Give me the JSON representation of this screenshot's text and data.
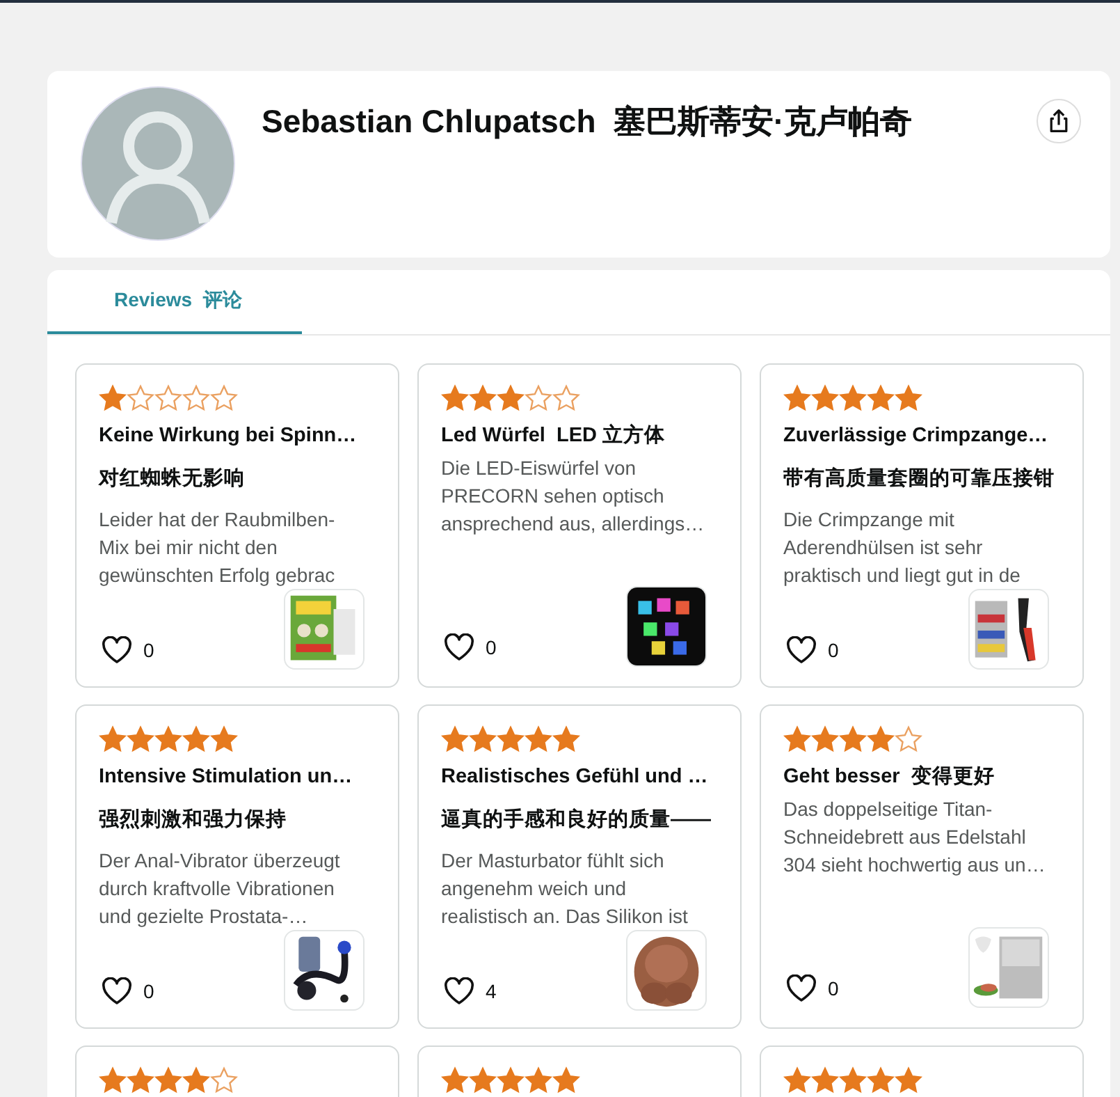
{
  "profile": {
    "name": "Sebastian Chlupatsch  塞巴斯蒂安·克卢帕奇"
  },
  "tabs": [
    {
      "label": "Reviews  评论",
      "selected": true
    }
  ],
  "reviews": [
    {
      "stars": 1,
      "title": "Keine Wirkung bei Spinn…",
      "subtitle": "对红蜘蛛无影响",
      "body_lines": [
        "Leider hat der Raubmilben-",
        "Mix bei mir nicht den",
        "gewünschten Erfolg gebrac"
      ],
      "likes": "0"
    },
    {
      "stars": 3,
      "title": "Led Würfel  LED 立方体",
      "body_lines": [
        "Die LED-Eiswürfel von",
        "PRECORN sehen optisch",
        "ansprechend aus, allerdings…"
      ],
      "likes": "0"
    },
    {
      "stars": 5,
      "title": "Zuverlässige Crimpzange…",
      "subtitle": "带有高质量套圈的可靠压接钳",
      "body_lines": [
        "Die Crimpzange mit",
        "Aderendhülsen ist sehr",
        "praktisch und liegt gut in de"
      ],
      "likes": "0"
    },
    {
      "stars": 5,
      "title": "Intensive Stimulation un…",
      "subtitle": "强烈刺激和强力保持",
      "body_lines": [
        "Der Anal-Vibrator überzeugt",
        "durch kraftvolle Vibrationen",
        "und gezielte Prostata-…"
      ],
      "likes": "0"
    },
    {
      "stars": 5,
      "title": "Realistisches Gefühl und …",
      "subtitle": "逼真的手感和良好的质量——",
      "body_lines": [
        "Der Masturbator fühlt sich",
        "angenehm weich und",
        "realistisch an. Das Silikon ist"
      ],
      "likes": "4"
    },
    {
      "stars": 4,
      "title": "Geht besser  变得更好",
      "body_lines": [
        "Das doppelseitige Titan-",
        "Schneidebrett aus Edelstahl",
        "304 sieht hochwertig aus un…"
      ],
      "likes": "0"
    },
    {
      "stars": 4
    },
    {
      "stars": 5
    },
    {
      "stars": 5
    }
  ]
}
